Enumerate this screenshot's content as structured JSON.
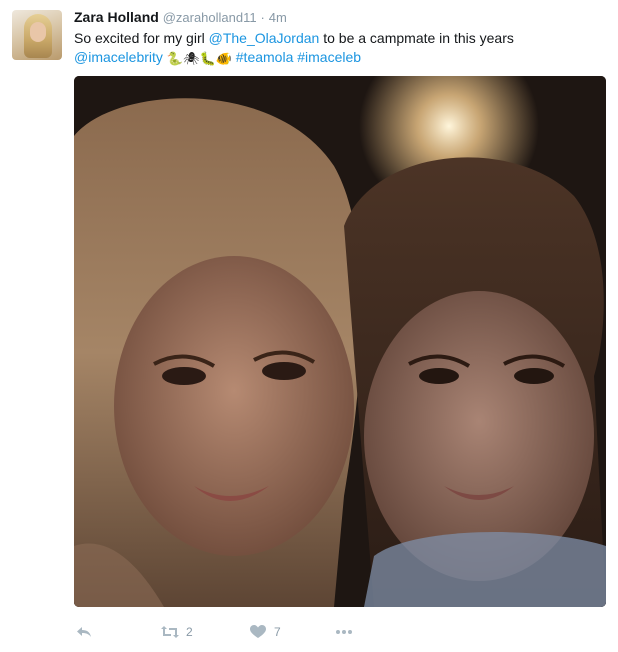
{
  "user": {
    "name": "Zara Holland",
    "handle": "@zaraholland11",
    "separator": "·",
    "time": "4m"
  },
  "tweet": {
    "text_before": "So excited for my girl ",
    "mention": "@The_OlaJordan",
    "text_after": " to be a campmate in this years",
    "mention2": "@imacelebrity",
    "emojis": [
      "🐍",
      "🕷",
      "🐛",
      "🐠"
    ],
    "hashtag1": "#teamola",
    "hashtag2": "#imaceleb"
  },
  "photo": {
    "icon": "selfie-photo"
  },
  "actions": {
    "reply_icon": "reply-icon",
    "retweet_icon": "retweet-icon",
    "retweet_count": "2",
    "like_icon": "heart-icon",
    "like_count": "7",
    "more_icon": "more-icon"
  },
  "colors": {
    "link": "#1b95e0",
    "meta": "#8899a6",
    "action": "#aab8c2"
  }
}
